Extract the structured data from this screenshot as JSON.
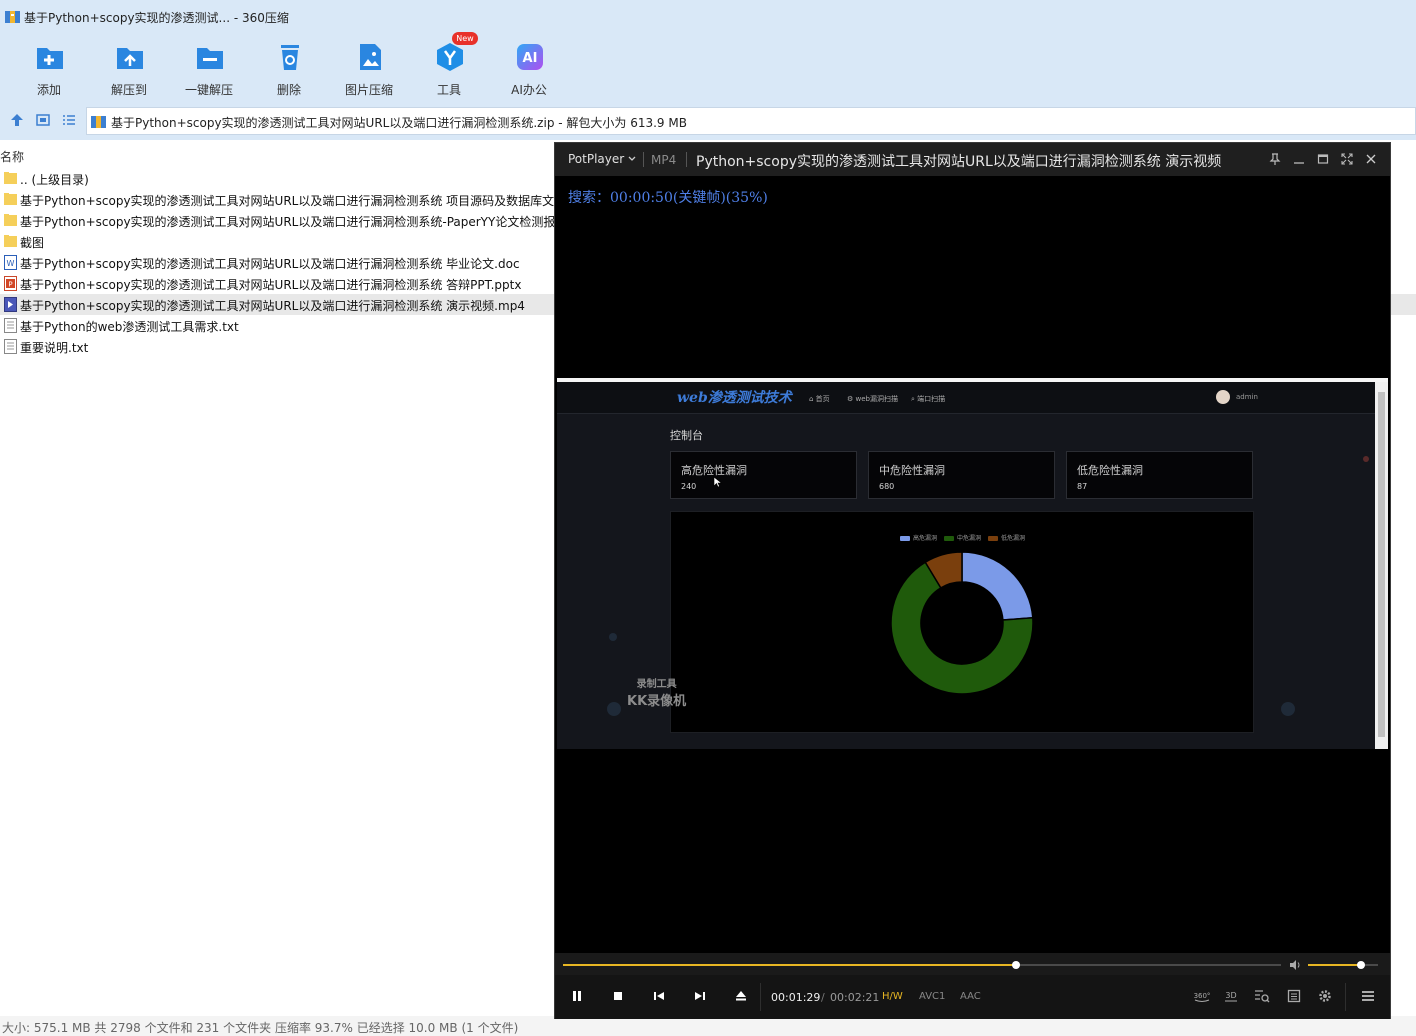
{
  "archiver": {
    "window_title": "基于Python+scopy实现的渗透测试... - 360压缩",
    "toolbar": {
      "add": "添加",
      "extract_to": "解压到",
      "one_click_extract": "一键解压",
      "delete": "删除",
      "image_compress": "图片压缩",
      "tools": "工具",
      "new_badge": "New",
      "ai_office": "AI办公"
    },
    "path": "基于Python+scopy实现的渗透测试工具对网站URL以及端口进行漏洞检测系统.zip - 解包大小为 613.9 MB",
    "column_name": "名称",
    "files": [
      {
        "name": ".. (上级目录)",
        "icon": "folder-icon"
      },
      {
        "name": "基于Python+scopy实现的渗透测试工具对网站URL以及端口进行漏洞检测系统 项目源码及数据库文件",
        "icon": "folder-icon"
      },
      {
        "name": "基于Python+scopy实现的渗透测试工具对网站URL以及端口进行漏洞检测系统-PaperYY论文检测报告",
        "icon": "folder-icon"
      },
      {
        "name": "截图",
        "icon": "folder-icon"
      },
      {
        "name": "基于Python+scopy实现的渗透测试工具对网站URL以及端口进行漏洞检测系统 毕业论文.doc",
        "icon": "word-doc-icon"
      },
      {
        "name": "基于Python+scopy实现的渗透测试工具对网站URL以及端口进行漏洞检测系统 答辩PPT.pptx",
        "icon": "ppt-icon"
      },
      {
        "name": "基于Python+scopy实现的渗透测试工具对网站URL以及端口进行漏洞检测系统 演示视频.mp4",
        "icon": "video-file-icon",
        "selected": true
      },
      {
        "name": "基于Python的web渗透测试工具需求.txt",
        "icon": "text-file-icon"
      },
      {
        "name": "重要说明.txt",
        "icon": "text-file-icon"
      }
    ],
    "status": "大小: 575.1 MB 共 2798 个文件和 231 个文件夹 压缩率 93.7% 已经选择 10.0 MB (1 个文件)"
  },
  "player": {
    "brand": "PotPlayer",
    "format": "MP4",
    "video_title": "Python+scopy实现的渗透测试工具对网站URL以及端口进行漏洞检测系统 演示视频",
    "osd": "搜索：00:00:50(关键帧)(35%)",
    "time_current": "00:01:29",
    "time_separator": "/",
    "time_total": "00:02:21",
    "tag_hw": "H/W",
    "tag_video": "AVC1",
    "tag_audio": "AAC",
    "seek_fraction": 0.631,
    "volume_fraction": 0.75,
    "colors": {
      "accent": "#e7b623",
      "osd": "#4f7fe6"
    }
  },
  "video": {
    "logo": "web渗透测试技术",
    "nav_home": "首页",
    "nav_web_scan": "web漏洞扫描",
    "nav_port_scan": "端口扫描",
    "user": "admin",
    "page_title": "控制台",
    "cards": [
      {
        "label": "高危险性漏洞",
        "value": "240"
      },
      {
        "label": "中危险性漏洞",
        "value": "680"
      },
      {
        "label": "低危险性漏洞",
        "value": "87"
      }
    ],
    "watermark_line1": "录制工具",
    "watermark_line2": "KK录像机"
  },
  "chart_data": {
    "type": "pie",
    "variant": "donut",
    "legend_position": "top-center",
    "slices": [
      {
        "name": "高危漏洞",
        "value": 240,
        "color": "#7b9ae8"
      },
      {
        "name": "中危漏洞",
        "value": 680,
        "color": "#1f5a0b"
      },
      {
        "name": "低危漏洞",
        "value": 87,
        "color": "#7a3f0d"
      }
    ]
  }
}
